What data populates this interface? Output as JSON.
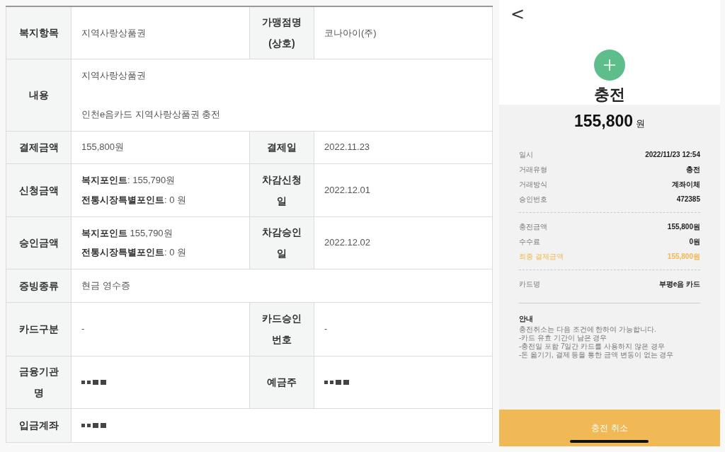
{
  "table": {
    "rows": [
      {
        "cells": [
          {
            "label": "복지항목",
            "value": {
              "kind": "text",
              "lines": [
                "지역사랑상품권"
              ]
            }
          },
          {
            "label": "가맹점명\n(상호)",
            "value": {
              "kind": "text",
              "lines": [
                "코나아이(주)"
              ]
            }
          }
        ]
      },
      {
        "cells": [
          {
            "label": "내용",
            "value": {
              "kind": "paragraphs",
              "lines": [
                "지역사랑상품권",
                "인천e음카드 지역사랑상품권 충전"
              ]
            }
          }
        ]
      },
      {
        "cells": [
          {
            "label": "결제금액",
            "value": {
              "kind": "text",
              "lines": [
                "155,800원"
              ]
            }
          },
          {
            "label": "결제일",
            "value": {
              "kind": "text",
              "lines": [
                "2022.11.23"
              ]
            }
          }
        ]
      },
      {
        "cells": [
          {
            "label": "신청금액",
            "value": {
              "kind": "text",
              "lines": [
                "**복지포인트**: 155,790원",
                "**전통시장특별포인트**: 0 원"
              ]
            }
          },
          {
            "label": "차감신청\n일",
            "value": {
              "kind": "text",
              "lines": [
                "2022.12.01"
              ]
            }
          }
        ]
      },
      {
        "cells": [
          {
            "label": "승인금액",
            "value": {
              "kind": "text",
              "lines": [
                "**복지포인트** 155,790원",
                "**전통시장특별포인트**: 0 원"
              ]
            }
          },
          {
            "label": "차감승인\n일",
            "value": {
              "kind": "text",
              "lines": [
                "2022.12.02"
              ]
            }
          }
        ]
      },
      {
        "cells": [
          {
            "label": "증빙종류",
            "value": {
              "kind": "text",
              "lines": [
                "현금 영수증"
              ]
            }
          }
        ]
      },
      {
        "cells": [
          {
            "label": "카드구분",
            "value": {
              "kind": "text",
              "lines": [
                "-"
              ]
            }
          },
          {
            "label": "카드승인\n번호",
            "value": {
              "kind": "text",
              "lines": [
                "-"
              ]
            }
          }
        ]
      },
      {
        "cells": [
          {
            "label": "금융기관\n명",
            "value": {
              "kind": "redacted"
            }
          },
          {
            "label": "예금주",
            "value": {
              "kind": "redacted"
            }
          }
        ]
      },
      {
        "cells": [
          {
            "label": "입금계좌",
            "value": {
              "kind": "redacted"
            }
          }
        ]
      }
    ]
  },
  "receipt": {
    "back": "<",
    "title": "충전",
    "amount": "155,800",
    "currency": "원",
    "sections": [
      {
        "rows": [
          {
            "label": "일시",
            "value": "2022/11/23 12:54",
            "highlight": false
          },
          {
            "label": "거래유형",
            "value": "충전",
            "highlight": false
          },
          {
            "label": "거래방식",
            "value": "계좌이체",
            "highlight": false
          },
          {
            "label": "승인번호",
            "value": "472385",
            "highlight": false
          }
        ]
      },
      {
        "rows": [
          {
            "label": "충전금액",
            "value": "155,800원",
            "highlight": false
          },
          {
            "label": "수수료",
            "value": "0원",
            "highlight": false
          },
          {
            "label": "최종 결제금액",
            "value": "155,800원",
            "highlight": true
          }
        ]
      },
      {
        "rows": [
          {
            "label": "카드명",
            "value": "부평e음 카드",
            "highlight": false
          }
        ]
      }
    ],
    "notice": {
      "title": "안내",
      "lines": [
        "충전취소는 다음 조건에 한하여 가능합니다.",
        "-카드 유효 기간이 남은 경우",
        "-충전일 포함 7일간 카드를 사용하지 않은 경우",
        "-돈 옮기기, 결제 등을 통한 금액 변동이 없는 경우"
      ]
    },
    "button": "충전 취소"
  }
}
